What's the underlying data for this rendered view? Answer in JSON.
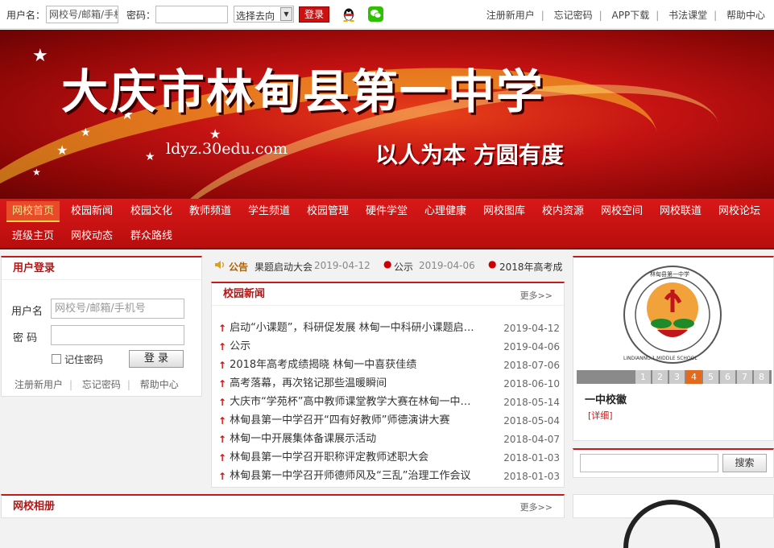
{
  "topbar": {
    "username_label": "用户名：",
    "username_placeholder": "网校号/邮箱/手机",
    "password_label": "密码：",
    "destination_select": "选择去向",
    "login_button": "登录",
    "links": [
      "注册新用户",
      "忘记密码",
      "APP下载",
      "书法课堂",
      "帮助中心"
    ]
  },
  "banner": {
    "title": "大庆市林甸县第一中学",
    "url": "ldyz.30edu.com",
    "motto": "以人为本  方圆有度"
  },
  "nav": {
    "row1": [
      "网校首页",
      "校园新闻",
      "校园文化",
      "教师频道",
      "学生频道",
      "校园管理",
      "硬件学堂",
      "心理健康",
      "网校图库",
      "校内资源",
      "网校空间",
      "网校联道",
      "网校论坛"
    ],
    "row2": [
      "班级主页",
      "网校动态",
      "群众路线"
    ]
  },
  "login": {
    "title": "用户登录",
    "username_label": "用户名",
    "username_placeholder": "网校号/邮箱/手机号",
    "password_label": "密 码",
    "remember_label": "记住密码",
    "login_button": "登 录",
    "links": [
      "注册新用户",
      "忘记密码",
      "帮助中心"
    ]
  },
  "notice": {
    "label": "公告",
    "items": [
      {
        "title": "果题启动大会",
        "date": "2019-04-12"
      },
      {
        "title": "公示",
        "date": "2019-04-06"
      },
      {
        "title": "2018年高考成",
        "date": ""
      }
    ]
  },
  "news": {
    "title": "校园新闻",
    "more": "更多>>",
    "items": [
      {
        "title": "启动“小课题”，科研促发展 林甸一中科研小课题启动大会",
        "date": "2019-04-12"
      },
      {
        "title": "公示",
        "date": "2019-04-06"
      },
      {
        "title": "2018年高考成绩揭晓 林甸一中喜获佳绩",
        "date": "2018-07-06"
      },
      {
        "title": "高考落幕，再次铭记那些温暖瞬间",
        "date": "2018-06-10"
      },
      {
        "title": "大庆市“学苑杯”高中教师课堂教学大赛在林甸一中举行",
        "date": "2018-05-14"
      },
      {
        "title": "林甸县第一中学召开“四有好教师”师德演讲大赛",
        "date": "2018-05-04"
      },
      {
        "title": "林甸一中开展集体备课展示活动",
        "date": "2018-04-07"
      },
      {
        "title": "林甸县第一中学召开职称评定教师述职大会",
        "date": "2018-01-03"
      },
      {
        "title": "林甸县第一中学召开师德师风及“三乱”治理工作会议",
        "date": "2018-01-03"
      }
    ]
  },
  "badge": {
    "ring_text": "林甸县第一中学",
    "ring_text_en": "LINDIANNO.1 MIDDLE SCHOOL",
    "pages": [
      "1",
      "2",
      "3",
      "4",
      "5",
      "6",
      "7",
      "8"
    ],
    "active_page": "4",
    "caption": "一中校徽",
    "detail": "[详细]"
  },
  "search": {
    "button": "搜索"
  },
  "album": {
    "title": "网校相册",
    "more": "更多>>"
  },
  "colors": {
    "brand_red": "#c81818",
    "nav_active": "#e84a2a",
    "badge_active": "#e06a20"
  }
}
